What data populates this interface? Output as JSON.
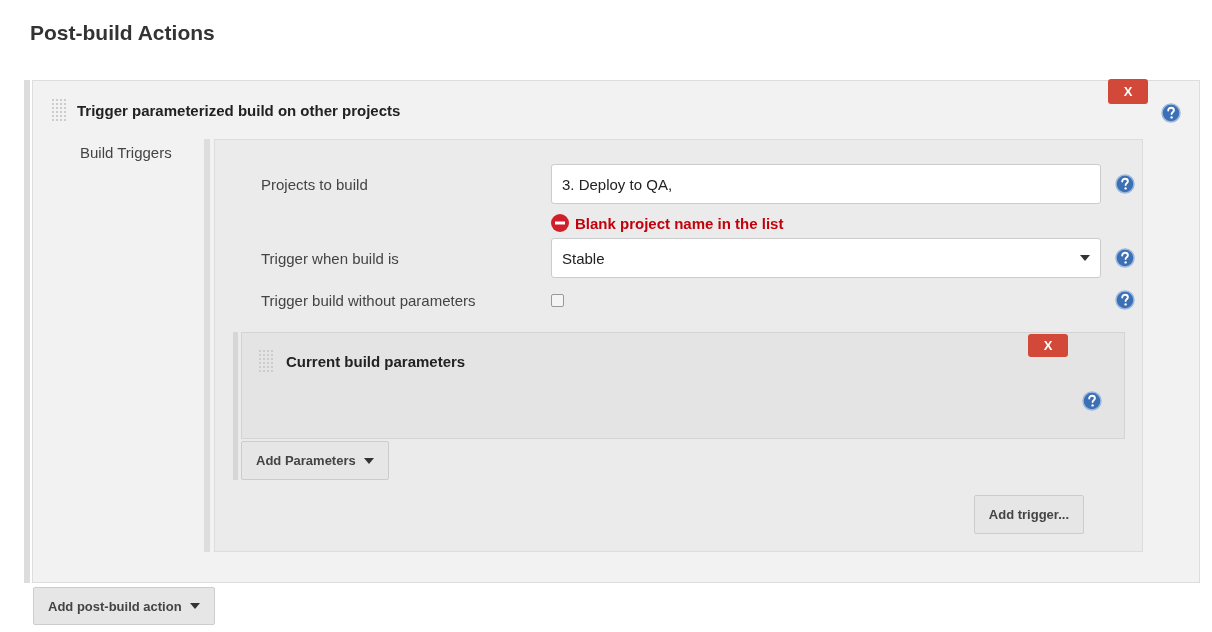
{
  "section_title": "Post-build Actions",
  "action": {
    "title": "Trigger parameterized build on other projects",
    "delete_label": "X",
    "group_label": "Build Triggers",
    "fields": [
      {
        "kind": "text",
        "label": "Projects to build",
        "value": "3. Deploy to QA,",
        "error": "Blank project name in the list"
      },
      {
        "kind": "select",
        "label": "Trigger when build is",
        "value": "Stable"
      },
      {
        "kind": "checkbox",
        "label": "Trigger build without parameters",
        "checked": false
      }
    ],
    "parameters": {
      "title": "Current build parameters",
      "delete_label": "X"
    },
    "add_parameters": "Add Parameters",
    "add_trigger": "Add trigger..."
  },
  "add_action": "Add post-build action"
}
